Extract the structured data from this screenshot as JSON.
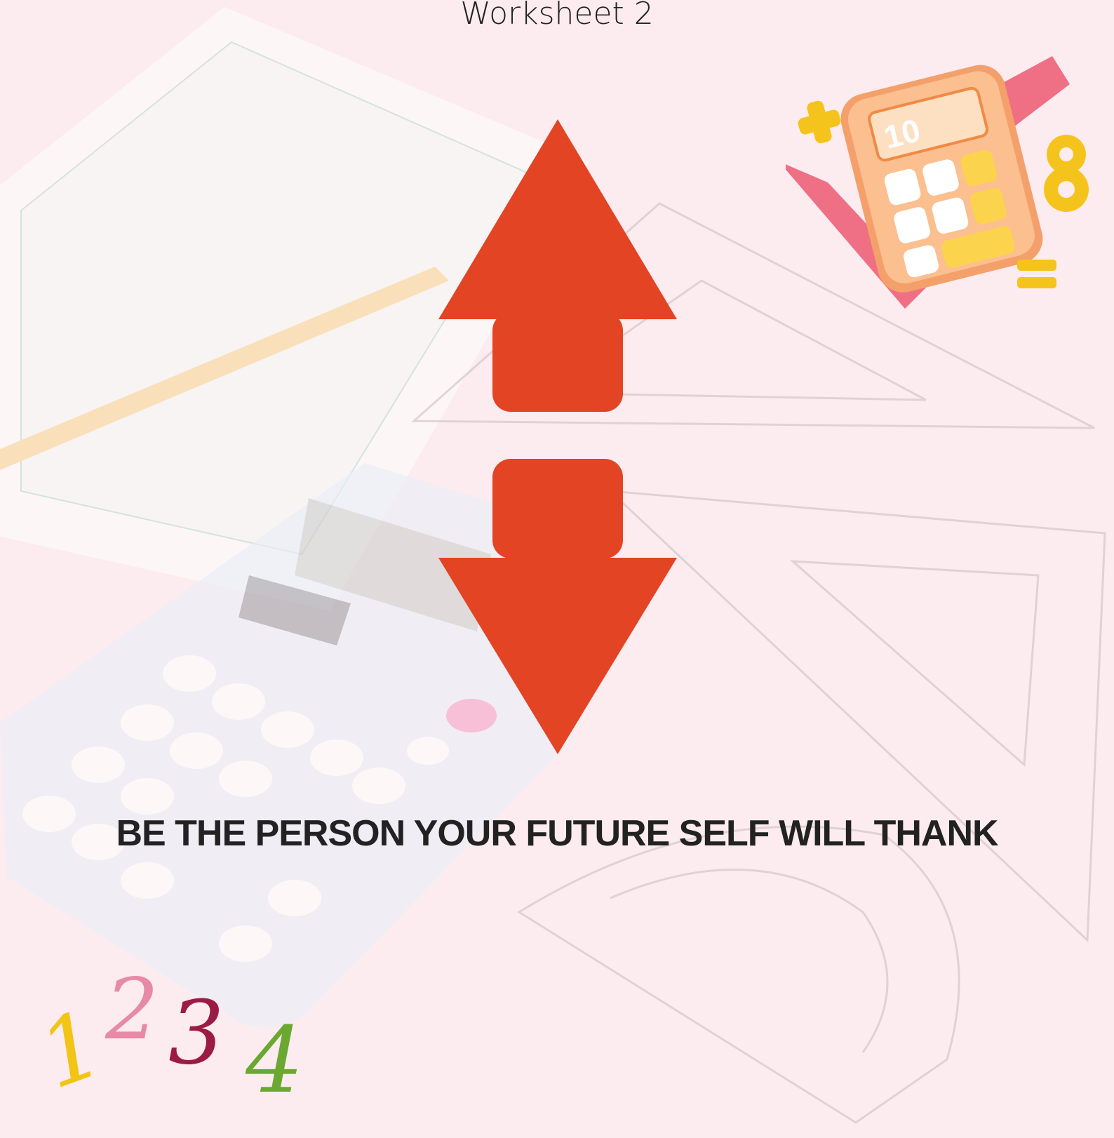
{
  "page": {
    "title": "Worksheet 2",
    "quote": "BE THE PERSON YOUR FUTURE SELF WILL THANK"
  },
  "decor": {
    "sticker_number": "10",
    "numbers": [
      "1",
      "2",
      "3",
      "4"
    ],
    "number_colors": [
      "#f2c416",
      "#e78aa6",
      "#9b1b45",
      "#6aa832"
    ],
    "arrow_color": "#e24424",
    "icons": [
      "up-arrow-icon",
      "down-arrow-icon",
      "calculator-icon",
      "ruler-icon",
      "plus-icon",
      "equals-icon",
      "eight-icon"
    ]
  }
}
